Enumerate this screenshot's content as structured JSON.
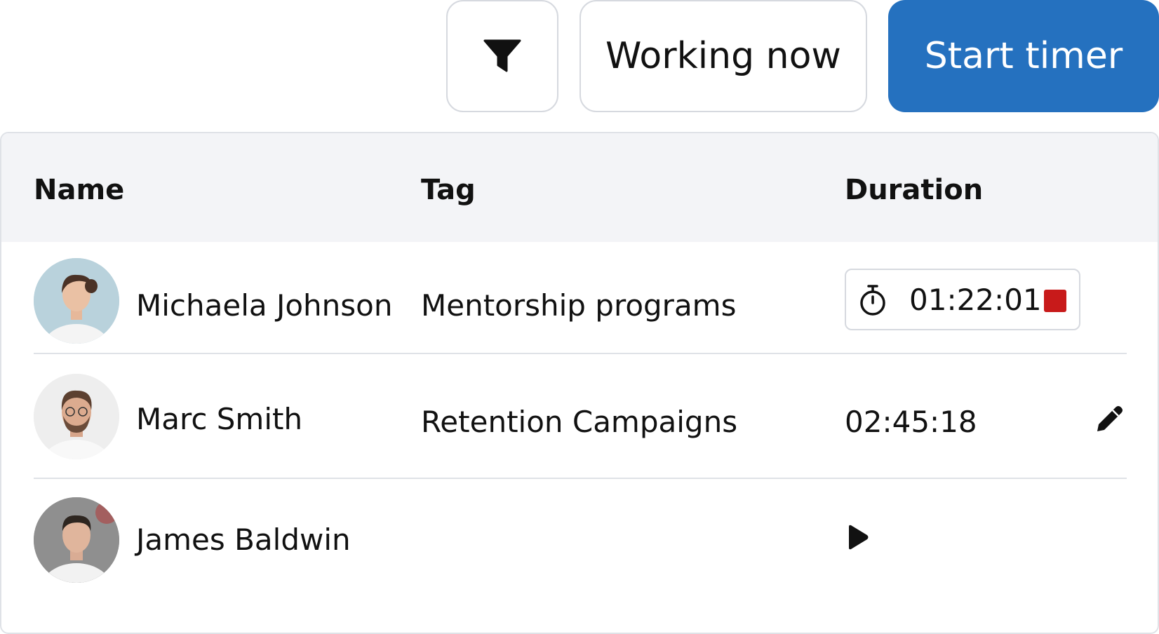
{
  "toolbar": {
    "filter_icon": "filter-icon",
    "working_now_label": "Working now",
    "start_timer_label": "Start timer"
  },
  "table": {
    "headers": {
      "name": "Name",
      "tag": "Tag",
      "duration": "Duration"
    },
    "rows": [
      {
        "name": "Michaela Johnson",
        "tag": "Mentorship programs",
        "duration": "01:22:01",
        "status": "running",
        "duration_icon": "stopwatch-icon",
        "action_icon": "stop-icon",
        "avatar_bg": "#b9d2dc"
      },
      {
        "name": "Marc Smith",
        "tag": "Retention Campaigns",
        "duration": "02:45:18",
        "status": "stopped",
        "action_icon": "pencil-icon",
        "avatar_bg": "#eeeeee"
      },
      {
        "name": "James Baldwin",
        "tag": "",
        "duration": "",
        "status": "idle",
        "action_icon": "play-icon",
        "avatar_bg": "#8f8f8f"
      }
    ]
  },
  "colors": {
    "primary": "#2571bf",
    "stop": "#c81a1a",
    "header_bg": "#f3f4f7",
    "border": "#dfe2e7"
  }
}
